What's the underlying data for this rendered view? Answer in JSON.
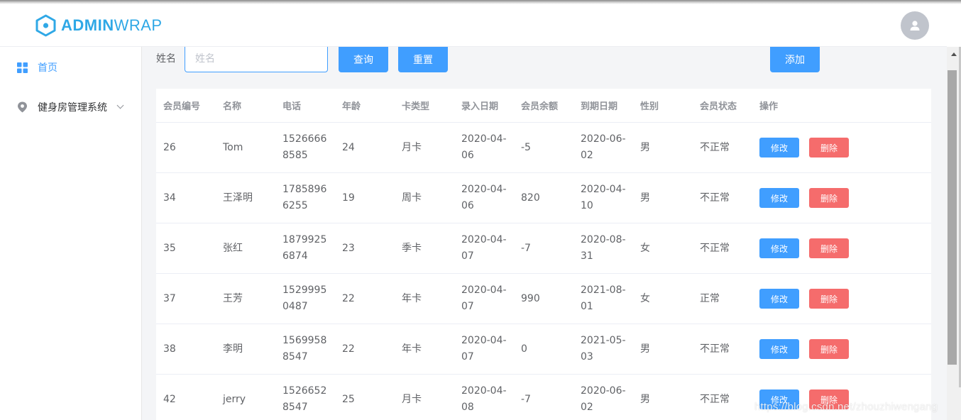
{
  "app": {
    "logo_bold": "ADMIN",
    "logo_light": "WRAP",
    "brand_color": "#2fa8e6",
    "avatar_icon": "user-icon"
  },
  "sidebar": {
    "items": [
      {
        "label": "首页",
        "icon": "grid-icon",
        "active": true
      },
      {
        "label": "健身房管理系统",
        "icon": "location-pin-icon",
        "expandable": true
      }
    ]
  },
  "search": {
    "label": "姓名",
    "placeholder": "姓名",
    "value": "",
    "query_button": "查询",
    "reset_button": "重置",
    "add_button": "添加"
  },
  "table": {
    "columns": [
      "会员编号",
      "名称",
      "电话",
      "年龄",
      "卡类型",
      "录入日期",
      "会员余额",
      "到期日期",
      "性别",
      "会员状态",
      "操作"
    ],
    "edit_label": "修改",
    "delete_label": "删除",
    "rows": [
      {
        "id": "26",
        "name": "Tom",
        "phone": "15266668585",
        "age": "24",
        "card": "月卡",
        "entry_date": "2020-04-06",
        "balance": "-5",
        "expire_date": "2020-06-02",
        "gender": "男",
        "status": "不正常"
      },
      {
        "id": "34",
        "name": "王泽明",
        "phone": "17858966255",
        "age": "19",
        "card": "周卡",
        "entry_date": "2020-04-06",
        "balance": "820",
        "expire_date": "2020-04-10",
        "gender": "男",
        "status": "不正常"
      },
      {
        "id": "35",
        "name": "张红",
        "phone": "18799256874",
        "age": "23",
        "card": "季卡",
        "entry_date": "2020-04-07",
        "balance": "-7",
        "expire_date": "2020-08-31",
        "gender": "女",
        "status": "不正常"
      },
      {
        "id": "37",
        "name": "王芳",
        "phone": "15299950487",
        "age": "22",
        "card": "年卡",
        "entry_date": "2020-04-07",
        "balance": "990",
        "expire_date": "2021-08-01",
        "gender": "女",
        "status": "正常"
      },
      {
        "id": "38",
        "name": "李明",
        "phone": "15699588547",
        "age": "22",
        "card": "年卡",
        "entry_date": "2020-04-07",
        "balance": "0",
        "expire_date": "2021-05-03",
        "gender": "男",
        "status": "不正常"
      },
      {
        "id": "42",
        "name": "jerry",
        "phone": "15266528547",
        "age": "25",
        "card": "月卡",
        "entry_date": "2020-04-08",
        "balance": "-7",
        "expire_date": "2020-06-02",
        "gender": "男",
        "status": "不正常"
      }
    ]
  },
  "watermark": "https://blog.csdn.net/zhouzhiwengang"
}
